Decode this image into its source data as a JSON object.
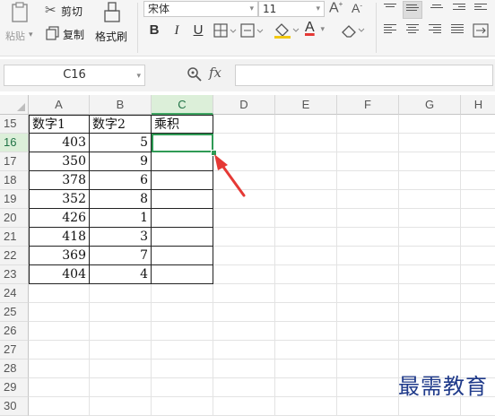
{
  "ribbon": {
    "paste": "粘贴",
    "cut": "剪切",
    "copy": "复制",
    "format_painter": "格式刷",
    "font_name": "宋体",
    "font_size": "11",
    "bold": "B",
    "italic": "I",
    "underline": "U",
    "font_color_letter": "A",
    "grow_font": "A",
    "shrink_font": "A"
  },
  "formula_bar": {
    "name_box": "C16",
    "fx_label": "fx",
    "formula": ""
  },
  "columns": [
    "A",
    "B",
    "C",
    "D",
    "E",
    "F",
    "G",
    "H"
  ],
  "active_column": "C",
  "rows": [
    "15",
    "16",
    "17",
    "18",
    "19",
    "20",
    "21",
    "22",
    "23",
    "24",
    "25",
    "26",
    "27",
    "28",
    "29",
    "30"
  ],
  "active_row": "16",
  "table": {
    "headers": [
      "数字1",
      "数字2",
      "乘积"
    ],
    "data": [
      [
        "403",
        "5",
        ""
      ],
      [
        "350",
        "9",
        ""
      ],
      [
        "378",
        "6",
        ""
      ],
      [
        "352",
        "8",
        ""
      ],
      [
        "426",
        "1",
        ""
      ],
      [
        "418",
        "3",
        ""
      ],
      [
        "369",
        "7",
        ""
      ],
      [
        "404",
        "4",
        ""
      ]
    ]
  },
  "selected_cell": "C16",
  "watermark": "最需教育",
  "colors": {
    "selection": "#2f9a55",
    "arrow": "#e53935",
    "watermark": "#1f3a8a"
  }
}
